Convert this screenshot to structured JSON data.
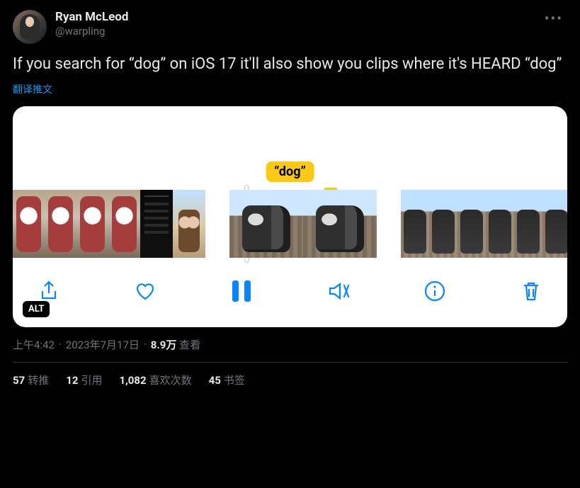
{
  "author": {
    "display_name": "Ryan McLeod",
    "handle": "@warpling"
  },
  "tweet": {
    "text": "If you search for “dog” on iOS 17 it'll also show you clips where it's HEARD “dog”",
    "translate_label": "翻译推文"
  },
  "media": {
    "caption_tag": "“dog”",
    "alt_badge": "ALT"
  },
  "meta": {
    "time": "上午4:42",
    "dot1": " · ",
    "date": "2023年7月17日",
    "dot2": " · ",
    "views_count": "8.9万",
    "views_label": " 查看"
  },
  "stats": {
    "retweets_count": "57",
    "retweets_label": "转推",
    "quotes_count": "12",
    "quotes_label": "引用",
    "likes_count": "1,082",
    "likes_label": "喜欢次数",
    "bookmarks_count": "45",
    "bookmarks_label": "书签"
  }
}
